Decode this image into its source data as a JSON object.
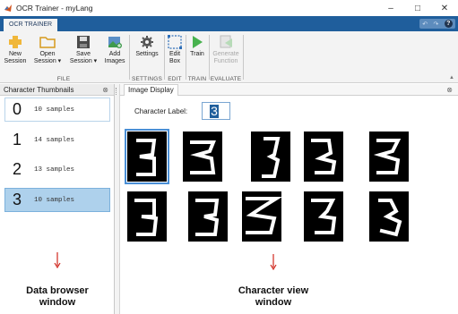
{
  "window": {
    "title": "OCR Trainer - myLang",
    "minimize": "–",
    "maximize": "□",
    "close": "✕"
  },
  "ribbon": {
    "active_tab": "OCR TRAINER",
    "quick_access": {
      "undo": "↶",
      "redo": "↷",
      "help": "?"
    },
    "groups": [
      {
        "label": "FILE",
        "tools": [
          {
            "label_line1": "New",
            "label_line2": "Session",
            "icon": "new-session-icon"
          },
          {
            "label_line1": "Open",
            "label_line2": "Session ▾",
            "icon": "open-folder-icon"
          },
          {
            "label_line1": "Save",
            "label_line2": "Session ▾",
            "icon": "save-floppy-icon"
          },
          {
            "label_line1": "Add",
            "label_line2": "Images",
            "icon": "add-images-icon"
          }
        ]
      },
      {
        "label": "SETTINGS",
        "tools": [
          {
            "label_line1": "Settings",
            "label_line2": "",
            "icon": "gear-icon"
          }
        ]
      },
      {
        "label": "EDIT",
        "tools": [
          {
            "label_line1": "Edit",
            "label_line2": "Box",
            "icon": "edit-box-icon"
          }
        ]
      },
      {
        "label": "TRAIN",
        "tools": [
          {
            "label_line1": "Train",
            "label_line2": "",
            "icon": "train-play-icon"
          }
        ]
      },
      {
        "label": "EVALUATE",
        "tools": [
          {
            "label_line1": "Generate",
            "label_line2": "Function",
            "icon": "generate-function-icon",
            "disabled": true
          }
        ]
      }
    ],
    "collapse": "▲"
  },
  "left_panel": {
    "title": "Character Thumbnails",
    "close": "⊗",
    "thumbnails": [
      {
        "digit": "0",
        "count": "10 samples"
      },
      {
        "digit": "1",
        "count": "14 samples"
      },
      {
        "digit": "2",
        "count": "13 samples"
      },
      {
        "digit": "3",
        "count": "10 samples"
      }
    ],
    "selected_index": 3
  },
  "right_panel": {
    "tab": "Image Display",
    "close": "⊗",
    "char_label_caption": "Character Label:",
    "char_label_value": "3",
    "sample_count": 10,
    "selected_sample": 0
  },
  "annotations": {
    "left_line1": "Data browser",
    "left_line2": "window",
    "right_line1": "Character view",
    "right_line2": "window",
    "arrow_color": "#d0281e"
  }
}
